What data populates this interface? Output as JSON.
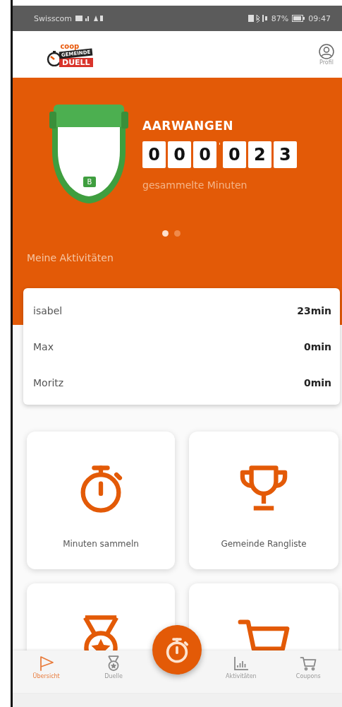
{
  "status_bar": {
    "carrier": "Swisscom",
    "battery": "87%",
    "time": "09:47"
  },
  "header": {
    "logo": {
      "top": "coop",
      "middle": "GEMEINDE",
      "bottom": "DUELL"
    },
    "profile_label": "Profil"
  },
  "hero": {
    "badge_letter": "B",
    "town": "AARWANGEN",
    "counter": {
      "groups": [
        [
          "0",
          "0",
          "0"
        ],
        [
          "0",
          "2",
          "3"
        ]
      ],
      "separator": "'"
    },
    "caption": "gesammelte Minuten",
    "dots": [
      {
        "selected": true
      },
      {
        "selected": false
      }
    ]
  },
  "activities": {
    "title": "Meine Aktivitäten",
    "rows": [
      {
        "name": "isabel",
        "minutes": "23min"
      },
      {
        "name": "Max",
        "minutes": "0min"
      },
      {
        "name": "Moritz",
        "minutes": "0min"
      }
    ]
  },
  "tiles": [
    {
      "kind": "stopwatch",
      "label": "Minuten sammeln"
    },
    {
      "kind": "trophy",
      "label": "Gemeinde Rangliste"
    },
    {
      "kind": "medal"
    },
    {
      "kind": "cart"
    }
  ],
  "tab_bar": {
    "tabs": [
      {
        "kind": "flag",
        "label": "Übersicht",
        "selected": true
      },
      {
        "kind": "medal",
        "label": "Duelle",
        "selected": false
      },
      {
        "kind": "fab"
      },
      {
        "kind": "chart",
        "label": "Aktivitäten",
        "selected": false
      },
      {
        "kind": "cart",
        "label": "Coupons",
        "selected": false
      }
    ]
  }
}
